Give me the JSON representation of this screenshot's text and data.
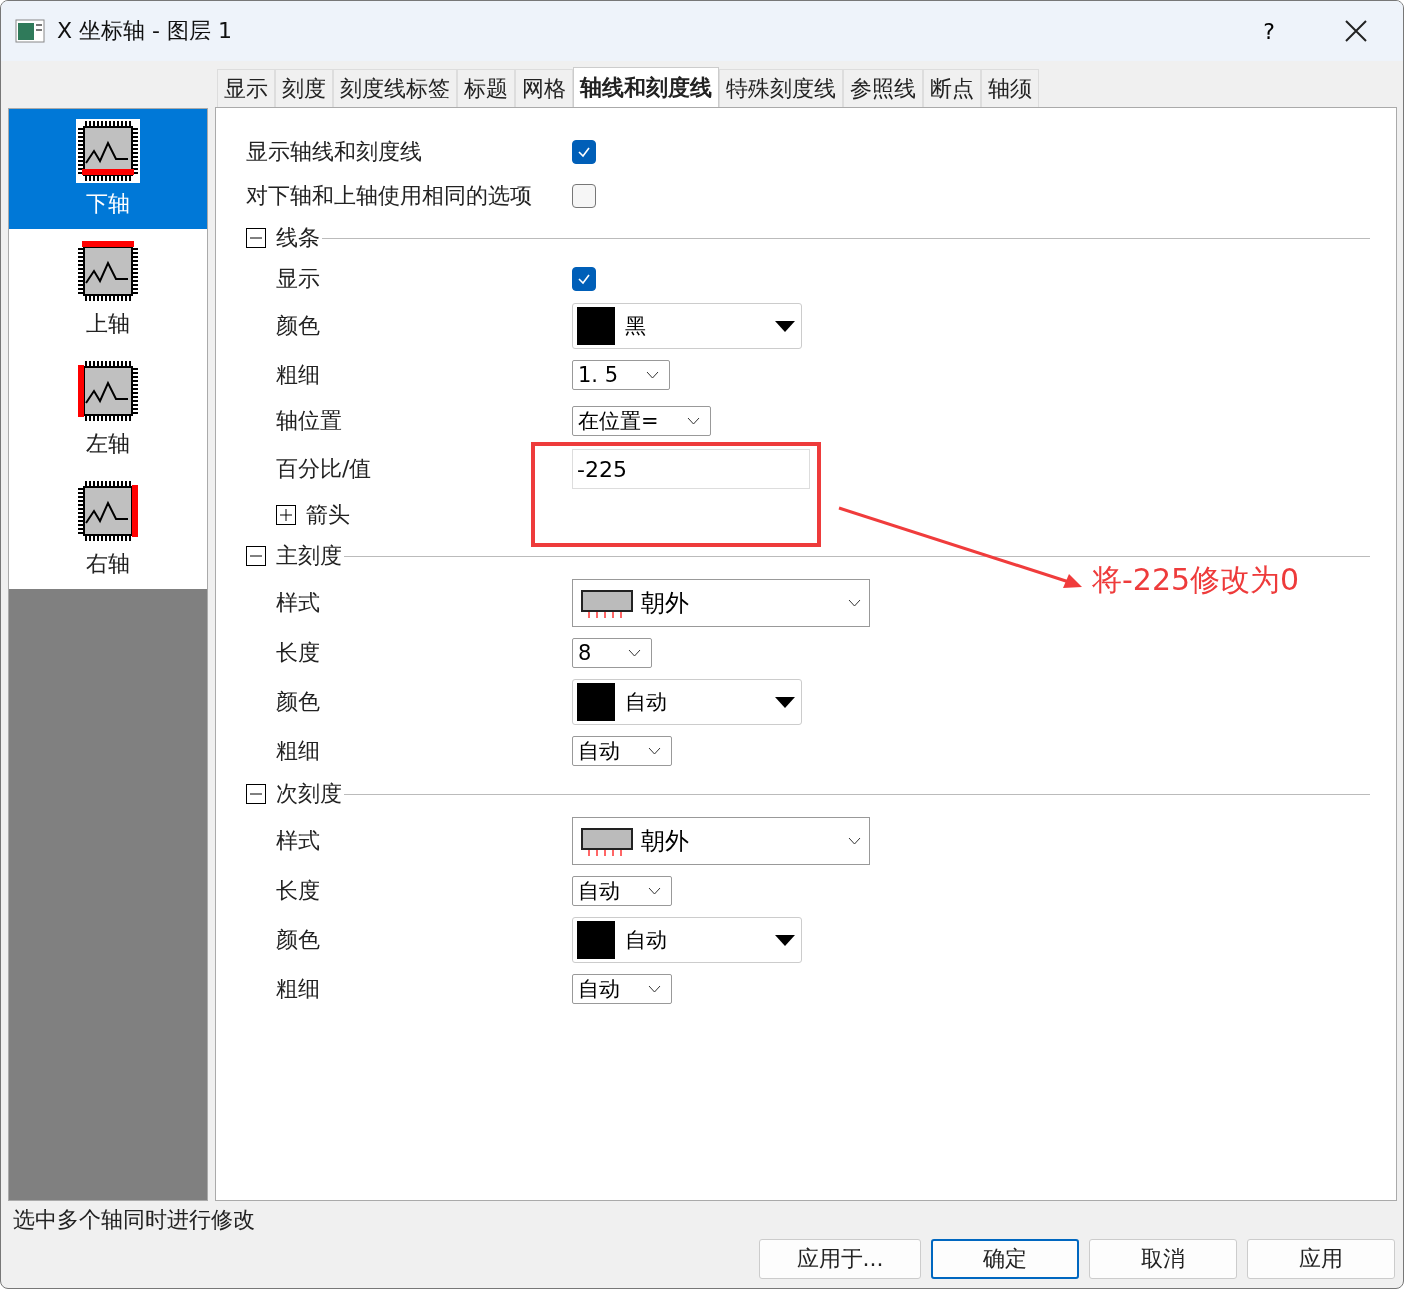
{
  "window": {
    "title": "X 坐标轴 - 图层 1",
    "help": "?"
  },
  "tabs": [
    {
      "label": "显示",
      "selected": false
    },
    {
      "label": "刻度",
      "selected": false
    },
    {
      "label": "刻度线标签",
      "selected": false
    },
    {
      "label": "标题",
      "selected": false
    },
    {
      "label": "网格",
      "selected": false
    },
    {
      "label": "轴线和刻度线",
      "selected": true
    },
    {
      "label": "特殊刻度线",
      "selected": false
    },
    {
      "label": "参照线",
      "selected": false
    },
    {
      "label": "断点",
      "selected": false
    },
    {
      "label": "轴须",
      "selected": false
    }
  ],
  "axes": [
    {
      "label": "下轴",
      "kind": "bottom",
      "selected": true
    },
    {
      "label": "上轴",
      "kind": "top",
      "selected": false
    },
    {
      "label": "左轴",
      "kind": "left",
      "selected": false
    },
    {
      "label": "右轴",
      "kind": "right",
      "selected": false
    }
  ],
  "form": [
    {
      "kind": "checkbox",
      "label": "显示轴线和刻度线",
      "checked": true
    },
    {
      "kind": "checkbox",
      "label": "对下轴和上轴使用相同的选项",
      "checked": false
    },
    {
      "kind": "section",
      "label": "线条",
      "expanded": true,
      "children": [
        {
          "kind": "checkbox",
          "label": "显示",
          "checked": true
        },
        {
          "kind": "color",
          "label": "颜色",
          "value": "黑",
          "color": "#000000"
        },
        {
          "kind": "select",
          "label": "粗细",
          "value": "1. 5"
        },
        {
          "kind": "select",
          "label": "轴位置",
          "value": "在位置="
        },
        {
          "kind": "input",
          "label": "百分比/值",
          "value": "-225"
        },
        {
          "kind": "section",
          "label": "箭头",
          "expanded": false
        }
      ]
    },
    {
      "kind": "section",
      "label": "主刻度",
      "expanded": true,
      "children": [
        {
          "kind": "style",
          "label": "样式",
          "value": "朝外"
        },
        {
          "kind": "select",
          "label": "长度",
          "value": "8"
        },
        {
          "kind": "color",
          "label": "颜色",
          "value": "自动",
          "color": "#000000"
        },
        {
          "kind": "select",
          "label": "粗细",
          "value": "自动"
        }
      ]
    },
    {
      "kind": "section",
      "label": "次刻度",
      "expanded": true,
      "children": [
        {
          "kind": "style",
          "label": "样式",
          "value": "朝外"
        },
        {
          "kind": "select",
          "label": "长度",
          "value": "自动"
        },
        {
          "kind": "color",
          "label": "颜色",
          "value": "自动",
          "color": "#000000"
        },
        {
          "kind": "select",
          "label": "粗细",
          "value": "自动"
        }
      ]
    }
  ],
  "annotation": {
    "text": "将-225修改为0"
  },
  "status": "选中多个轴同时进行修改",
  "buttons": [
    {
      "label": "应用于...",
      "default": false
    },
    {
      "label": "确定",
      "default": true
    },
    {
      "label": "取消",
      "default": false
    },
    {
      "label": "应用",
      "default": false
    }
  ]
}
